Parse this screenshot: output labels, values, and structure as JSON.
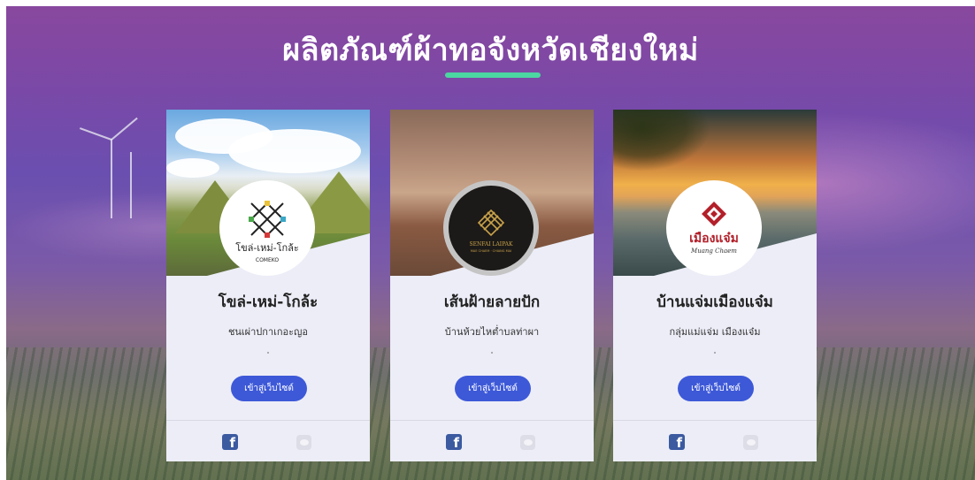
{
  "page": {
    "title": "ผลิตภัณฑ์ผ้าทอจังหวัดเชียงใหม่",
    "accent_color": "#4cd6a1",
    "button_color": "#3d59d8"
  },
  "cards": [
    {
      "name": "โขล่-เหม่-โกล้ะ",
      "description": "ชนเผ่าปกาเกอะญอ",
      "button_label": "เข้าสู่เว็บไซต์",
      "logo_text": "โขล่-เหม่-โกล้ะ",
      "logo_subtext": "COMEKO",
      "icons": [
        "facebook-icon",
        "line-icon"
      ]
    },
    {
      "name": "เส้นฝ้ายลายปัก",
      "description": "บ้านห้วยไหต่ำบลท่าผา",
      "button_label": "เข้าสู่เว็บไซต์",
      "logo_text": "SENFAI LAIPAK",
      "logo_subtext": "MAE CHAEM · CHIANG MAI",
      "icons": [
        "facebook-icon",
        "line-icon"
      ]
    },
    {
      "name": "บ้านแจ่มเมืองแจ๋ม",
      "description": "กลุ่มแม่แจ่ม เมืองแจ๋ม",
      "button_label": "เข้าสู่เว็บไซต์",
      "logo_text": "เมืองแจ๋ม",
      "logo_subtext": "Muang Chaem",
      "icons": [
        "facebook-icon",
        "line-icon"
      ]
    }
  ]
}
